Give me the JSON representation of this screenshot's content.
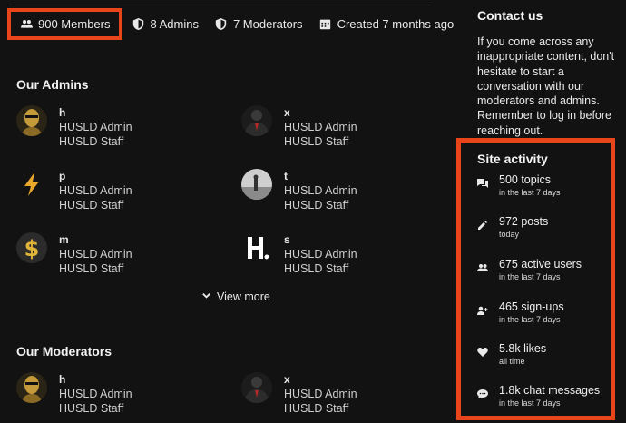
{
  "stats": {
    "members": "900 Members",
    "admins": "8 Admins",
    "moderators": "7 Moderators",
    "created": "Created 7 months ago"
  },
  "admins_section": {
    "title": "Our Admins",
    "people": [
      {
        "username": "h",
        "title": "HUSLD Admin",
        "group": "HUSLD Staff",
        "avatar": "bust-statue"
      },
      {
        "username": "x",
        "title": "HUSLD Admin",
        "group": "HUSLD Staff",
        "avatar": "suit-figure"
      },
      {
        "username": "p",
        "title": "HUSLD Admin",
        "group": "HUSLD Staff",
        "avatar": "lightning-bolt"
      },
      {
        "username": "t",
        "title": "HUSLD Admin",
        "group": "HUSLD Staff",
        "avatar": "grey-photo"
      },
      {
        "username": "m",
        "title": "HUSLD Admin",
        "group": "HUSLD Staff",
        "avatar": "gold-dollar"
      },
      {
        "username": "s",
        "title": "HUSLD Admin",
        "group": "HUSLD Staff",
        "avatar": "h-logo"
      }
    ],
    "view_more": "View more"
  },
  "moderators_section": {
    "title": "Our Moderators",
    "people": [
      {
        "username": "h",
        "title": "HUSLD Admin",
        "group": "HUSLD Staff",
        "avatar": "bust-statue"
      },
      {
        "username": "x",
        "title": "HUSLD Admin",
        "group": "HUSLD Staff",
        "avatar": "suit-figure"
      }
    ]
  },
  "contact": {
    "title": "Contact us",
    "text": "If you come across any inappropriate content, don't hesitate to start a conversation with our moderators and admins. Remember to log in before reaching out."
  },
  "activity": {
    "title": "Site activity",
    "items": [
      {
        "value": "500 topics",
        "period": "in the last 7 days",
        "icon": "topics-icon"
      },
      {
        "value": "972 posts",
        "period": "today",
        "icon": "pencil-icon"
      },
      {
        "value": "675 active users",
        "period": "in the last 7 days",
        "icon": "users-icon"
      },
      {
        "value": "465 sign-ups",
        "period": "in the last 7 days",
        "icon": "user-plus-icon"
      },
      {
        "value": "5.8k likes",
        "period": "all time",
        "icon": "heart-icon"
      },
      {
        "value": "1.8k chat messages",
        "period": "in the last 7 days",
        "icon": "chat-icon"
      }
    ]
  },
  "colors": {
    "background": "#121212",
    "highlight": "#e8451b",
    "text": "#e9e9e9"
  }
}
